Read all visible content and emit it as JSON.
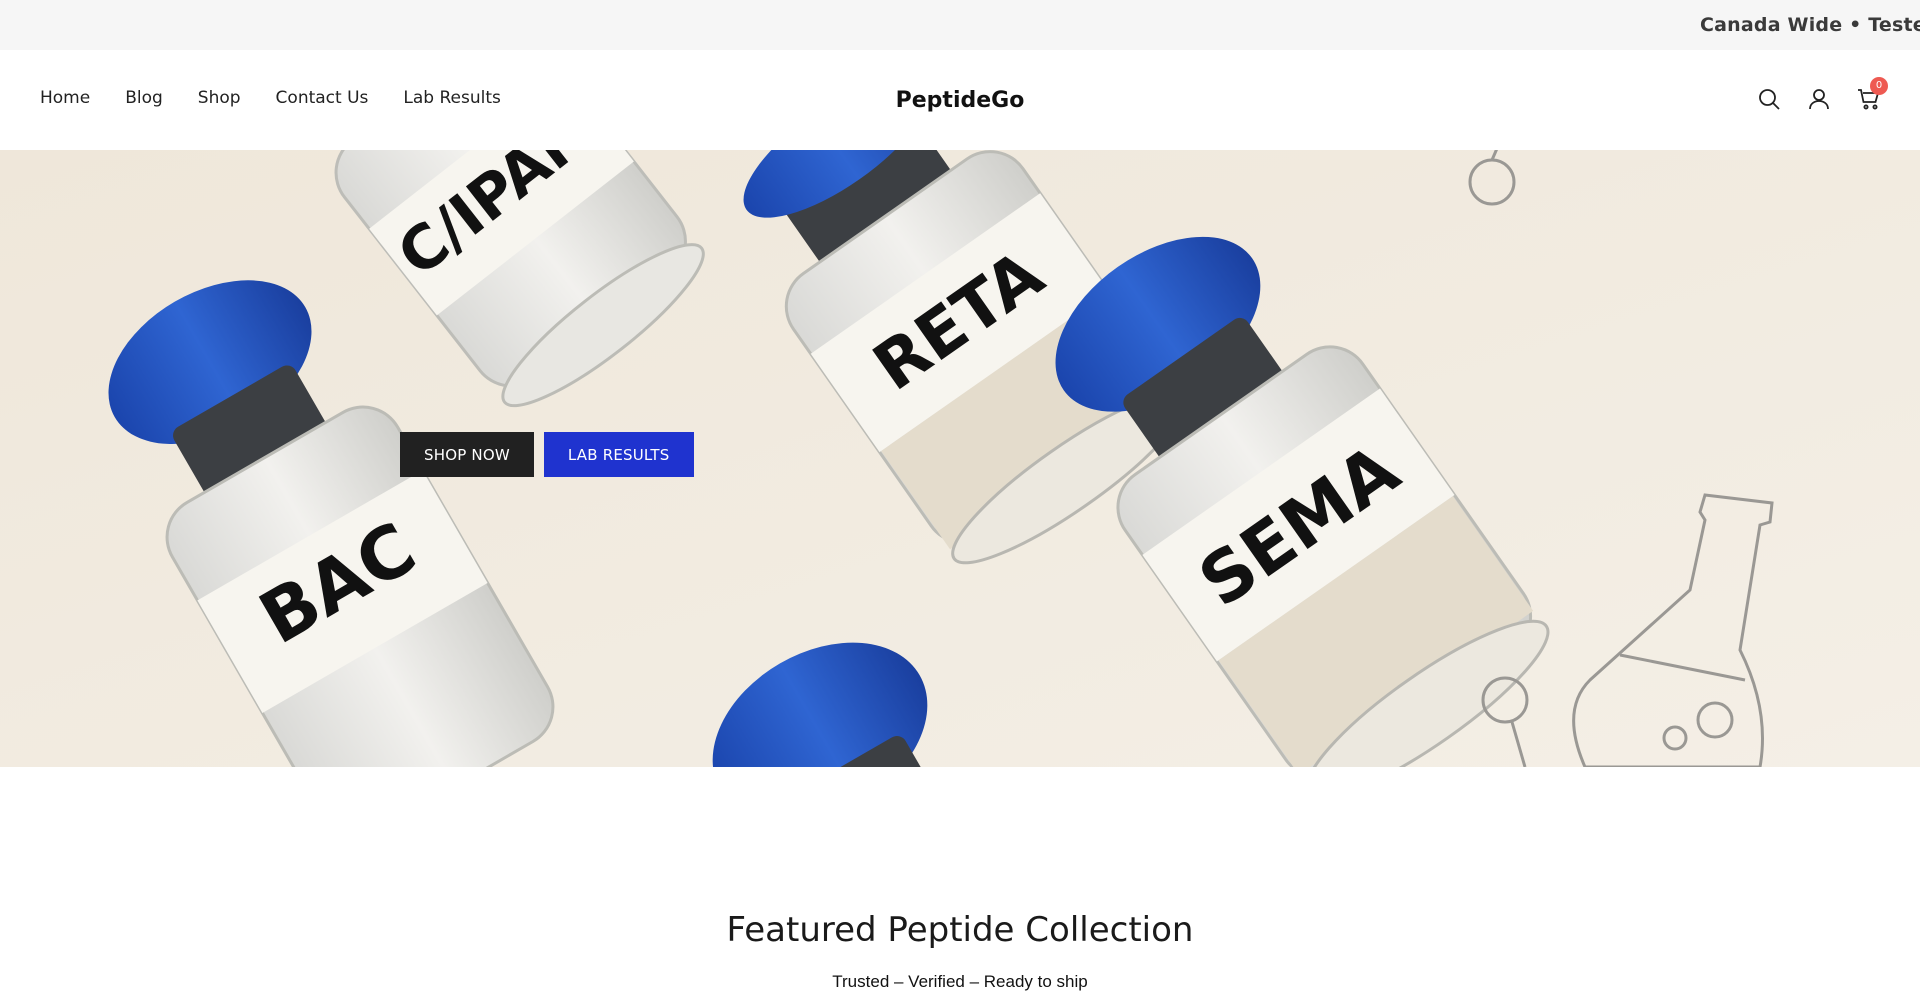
{
  "announcement": {
    "text": "Canada Wide • Tested W"
  },
  "header": {
    "nav": [
      "Home",
      "Blog",
      "Shop",
      "Contact Us",
      "Lab Results"
    ],
    "logo": "PeptideGo",
    "cart_count": "0"
  },
  "hero": {
    "vial_labels": [
      "C/IPAM",
      "RETA",
      "BAC",
      "SEMA"
    ],
    "shop_now_label": "SHOP NOW",
    "lab_results_label": "LAB RESULTS"
  },
  "featured": {
    "title": "Featured Peptide Collection",
    "subtitle": "Trusted – Verified – Ready to ship"
  },
  "colors": {
    "cap_blue": "#2056c4",
    "button_blue": "#1f33cf",
    "button_dark": "#212121",
    "badge_red": "#ee5a52",
    "hero_bg": "#f1ebe0"
  },
  "icons": [
    "search-icon",
    "account-icon",
    "cart-icon"
  ]
}
